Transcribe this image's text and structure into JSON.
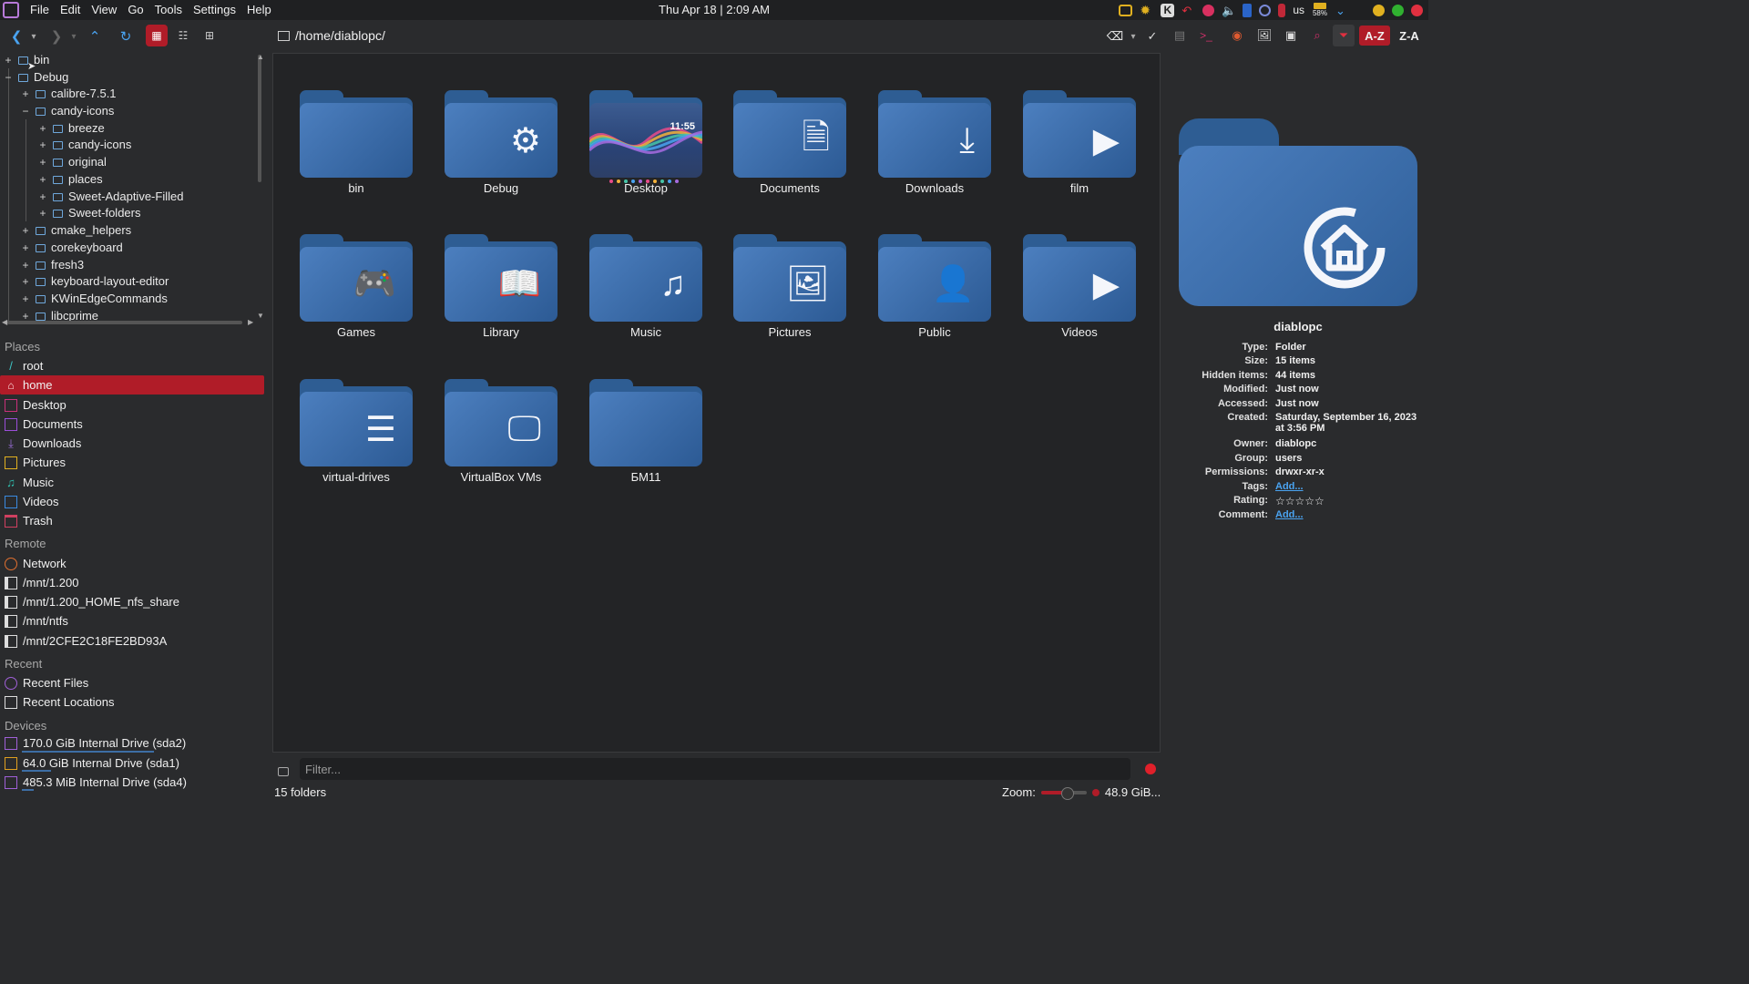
{
  "menubar": {
    "items": [
      "File",
      "Edit",
      "View",
      "Go",
      "Tools",
      "Settings",
      "Help"
    ],
    "clock": "Thu Apr 18 |  2:09 AM",
    "keyboard_layout": "us",
    "battery_percent": "58%"
  },
  "toolbar": {
    "path": "/home/diablopc/",
    "sort_az": "A-Z",
    "sort_za": "Z-A"
  },
  "tree": [
    {
      "label": "bin",
      "expander": "+"
    },
    {
      "label": "Debug",
      "expander": "−"
    },
    {
      "label": "calibre-7.5.1",
      "expander": "+"
    },
    {
      "label": "candy-icons",
      "expander": "−"
    },
    {
      "label": "breeze",
      "expander": "+"
    },
    {
      "label": "candy-icons",
      "expander": "+"
    },
    {
      "label": "original",
      "expander": "+"
    },
    {
      "label": "places",
      "expander": "+"
    },
    {
      "label": "Sweet-Adaptive-Filled",
      "expander": "+"
    },
    {
      "label": "Sweet-folders",
      "expander": "+"
    },
    {
      "label": "cmake_helpers",
      "expander": "+"
    },
    {
      "label": "corekeyboard",
      "expander": "+"
    },
    {
      "label": "fresh3",
      "expander": "+"
    },
    {
      "label": "keyboard-layout-editor",
      "expander": "+"
    },
    {
      "label": "KWinEdgeCommands",
      "expander": "+"
    },
    {
      "label": "libcprime",
      "expander": "+"
    }
  ],
  "places": {
    "places_title": "Places",
    "places": [
      {
        "label": "root",
        "icon": "slash-icon"
      },
      {
        "label": "home",
        "icon": "home-icon"
      },
      {
        "label": "Desktop",
        "icon": "desktop-icon"
      },
      {
        "label": "Documents",
        "icon": "document-icon"
      },
      {
        "label": "Downloads",
        "icon": "download-icon"
      },
      {
        "label": "Pictures",
        "icon": "picture-icon"
      },
      {
        "label": "Music",
        "icon": "music-icon"
      },
      {
        "label": "Videos",
        "icon": "video-icon"
      },
      {
        "label": "Trash",
        "icon": "trash-icon"
      }
    ],
    "remote_title": "Remote",
    "remote": [
      {
        "label": "Network",
        "icon": "network-icon"
      },
      {
        "label": "/mnt/1.200",
        "icon": "drive-icon"
      },
      {
        "label": "/mnt/1.200_HOME_nfs_share",
        "icon": "drive-icon"
      },
      {
        "label": "/mnt/ntfs",
        "icon": "drive-icon"
      },
      {
        "label": "/mnt/2CFE2C18FE2BD93A",
        "icon": "drive-icon"
      }
    ],
    "recent_title": "Recent",
    "recent": [
      {
        "label": "Recent Files",
        "icon": "recent-files-icon"
      },
      {
        "label": "Recent Locations",
        "icon": "recent-locations-icon"
      }
    ],
    "devices_title": "Devices",
    "devices": [
      {
        "label": "170.0 GiB Internal Drive (sda2)",
        "usage": 0.55
      },
      {
        "label": "64.0 GiB Internal Drive (sda1)",
        "usage": 0.12
      },
      {
        "label": "485.3 MiB Internal Drive (sda4)",
        "usage": 0.05
      }
    ]
  },
  "folders": [
    {
      "label": "bin",
      "icon": "plain-folder-icon",
      "glyph": ""
    },
    {
      "label": "Debug",
      "icon": "gear-icon",
      "glyph": "⚙"
    },
    {
      "label": "Desktop",
      "icon": "wallpaper-thumbnail",
      "glyph": "",
      "clock": "11:55"
    },
    {
      "label": "Documents",
      "icon": "document-icon",
      "glyph": "🗎"
    },
    {
      "label": "Downloads",
      "icon": "download-icon",
      "glyph": "⤓"
    },
    {
      "label": "film",
      "icon": "play-icon",
      "glyph": "▶"
    },
    {
      "label": "Games",
      "icon": "gamepad-icon",
      "glyph": "🎮"
    },
    {
      "label": "Library",
      "icon": "book-icon",
      "glyph": "📖"
    },
    {
      "label": "Music",
      "icon": "music-note-icon",
      "glyph": "♫"
    },
    {
      "label": "Pictures",
      "icon": "image-icon",
      "glyph": "🖼"
    },
    {
      "label": "Public",
      "icon": "person-icon",
      "glyph": "👤"
    },
    {
      "label": "Videos",
      "icon": "play-icon",
      "glyph": "▶"
    },
    {
      "label": "virtual-drives",
      "icon": "server-icon",
      "glyph": "☰"
    },
    {
      "label": "VirtualBox VMs",
      "icon": "monitor-icon",
      "glyph": "🖵"
    },
    {
      "label": "БМ11",
      "icon": "plain-folder-icon",
      "glyph": ""
    }
  ],
  "filter": {
    "placeholder": "Filter..."
  },
  "status": {
    "folder_count": "15 folders",
    "zoom_label": "Zoom:",
    "zoom_level": 0.55,
    "free_space": "48.9 GiB..."
  },
  "info": {
    "name": "diablopc",
    "rows": [
      {
        "key": "Type:",
        "value": "Folder"
      },
      {
        "key": "Size:",
        "value": "15 items"
      },
      {
        "key": "Hidden items:",
        "value": "44 items"
      },
      {
        "key": "Modified:",
        "value": "Just now"
      },
      {
        "key": "Accessed:",
        "value": "Just now"
      },
      {
        "key": "Created:",
        "value": "Saturday, September 16, 2023 at 3:56 PM"
      },
      {
        "key": "Owner:",
        "value": "diablopc"
      },
      {
        "key": "Group:",
        "value": "users"
      },
      {
        "key": "Permissions:",
        "value": "drwxr-xr-x"
      },
      {
        "key": "Tags:",
        "value": "Add..."
      },
      {
        "key": "Rating:",
        "value": "☆☆☆☆☆"
      },
      {
        "key": "Comment:",
        "value": "Add..."
      }
    ]
  },
  "colors": {
    "accent": "#b01c28",
    "folder": "#3a6aa8",
    "link": "#4aa3f0"
  }
}
